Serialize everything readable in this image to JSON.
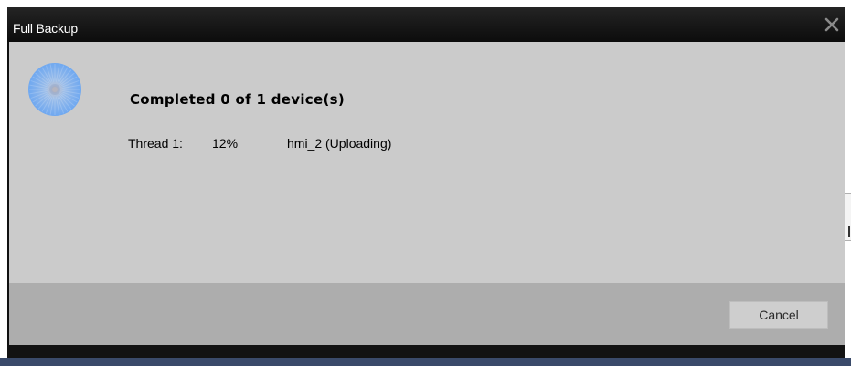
{
  "window": {
    "title": "Full Backup"
  },
  "icons": {
    "close": "close-icon",
    "spinner": "loading-spinner-icon"
  },
  "colors": {
    "titlebar": "#101010",
    "content_bg": "#cbcbcb",
    "footer_bg": "#adadad",
    "spinner": "#7fb2f2"
  },
  "status": {
    "heading": "Completed 0 of 1 device(s)",
    "threads": [
      {
        "label": "Thread 1:",
        "percent": "12%",
        "device": "hmi_2 (Uploading)"
      }
    ]
  },
  "actions": {
    "cancel_label": "Cancel"
  }
}
